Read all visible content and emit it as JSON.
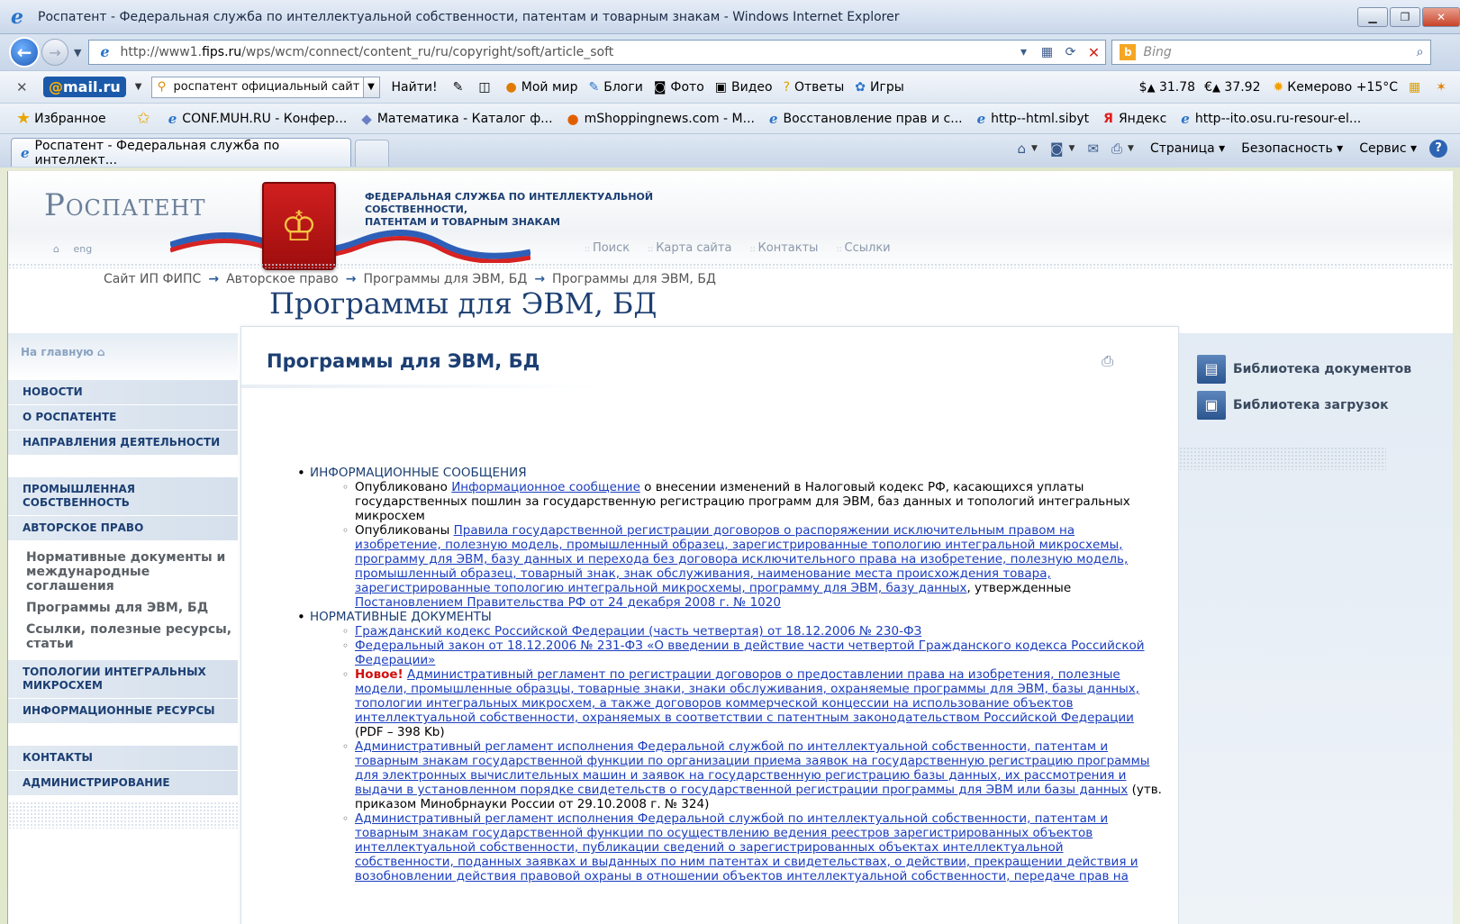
{
  "window": {
    "title": "Роспатент - Федеральная служба по интеллектуальной собственности, патентам и товарным знакам - Windows Internet Explorer"
  },
  "address_bar": {
    "url_prefix": "http://www1.",
    "url_domain": "fips.ru",
    "url_path": "/wps/wcm/connect/content_ru/ru/copyright/soft/article_soft",
    "search_placeholder": "Bing"
  },
  "mail_toolbar": {
    "logo_at": "@",
    "logo_text": "mail.ru",
    "search_value": "роспатент официальный сайт",
    "find_label": "Найти!",
    "items": [
      "Мой мир",
      "Блоги",
      "Фото",
      "Видео",
      "Ответы",
      "Игры"
    ],
    "usd": "31.78",
    "eur": "37.92",
    "weather": "Кемерово +15°C"
  },
  "favorites": {
    "label": "Избранное",
    "items": [
      "CONF.MUH.RU - Конфер...",
      "Математика - Каталог ф...",
      "mShoppingnews.com - M...",
      "Восстановление прав и с...",
      "http--html.sibyt",
      "Яндекс",
      "http--ito.osu.ru-resour-el..."
    ]
  },
  "tab": {
    "title": "Роспатент - Федеральная служба по интеллект..."
  },
  "commands": {
    "page": "Страница",
    "safety": "Безопасность",
    "service": "Сервис"
  },
  "site": {
    "logo": "Роспатент",
    "lang": "eng",
    "agency_line1": "ФЕДЕРАЛЬНАЯ СЛУЖБА ПО ИНТЕЛЛЕКТУАЛЬНОЙ СОБСТВЕННОСТИ,",
    "agency_line2": "ПАТЕНТАМ И ТОВАРНЫМ ЗНАКАМ",
    "top_links": [
      "Поиск",
      "Карта сайта",
      "Контакты",
      "Ссылки"
    ],
    "breadcrumbs": [
      "Сайт ИП ФИПС",
      "Авторское право",
      "Программы для ЭВМ, БД",
      "Программы для ЭВМ, БД"
    ],
    "page_title": "Программы для ЭВМ, БД"
  },
  "left_nav": {
    "home": "На главную",
    "items_top": [
      "Новости",
      "О Роспатенте",
      "Направления деятельности"
    ],
    "items_mid": [
      "Промышленная собственность",
      "Авторское право"
    ],
    "sub_items": [
      "Нормативные документы и международные соглашения",
      "Программы для ЭВМ, БД",
      "Ссылки, полезные ресурсы, статьи"
    ],
    "items_after": [
      "Топологии интегральных микросхем",
      "Информационные ресурсы"
    ],
    "items_bottom": [
      "Контакты",
      "Администрирование"
    ]
  },
  "content": {
    "title": "Программы для ЭВМ, БД",
    "section1": {
      "heading": "ИНФОРМАЦИОННЫЕ СООБЩЕНИЯ",
      "item1_prefix": "Опубликовано ",
      "item1_link": "Информационное сообщение",
      "item1_suffix": " о внесении изменений в Налоговый кодекс РФ, касающихся уплаты государственных пошлин за государственную регистрацию программ для ЭВМ, баз данных и топологий интегральных микросхем",
      "item2_prefix": "Опубликованы ",
      "item2_link": "Правила государственной регистрации договоров о распоряжении исключительным правом на изобретение, полезную модель, промышленный образец, зарегистрированные топологию интегральной микросхемы, программу для ЭВМ, базу данных и перехода без договора исключительного права на изобретение, полезную модель, промышленный образец, товарный знак, знак обслуживания, наименование места происхождения товара, зарегистрированные топологию интегральной микросхемы, программу для ЭВМ, базу данных",
      "item2_mid": ", утвержденные ",
      "item2_link2": "Постановлением Правительства РФ от 24 декабря 2008 г. № 1020"
    },
    "section2": {
      "heading": "НОРМАТИВНЫЕ ДОКУМЕНТЫ",
      "doc1": "Гражданский кодекс Российской Федерации (часть четвертая) от 18.12.2006 № 230-ФЗ",
      "doc2": "Федеральный закон от 18.12.2006 № 231-ФЗ «О введении в действие части четвертой Гражданского кодекса Российской Федерации»",
      "doc3_badge": "Новое!",
      "doc3": "Административный регламент по регистрации договоров о предоставлении права на изобретения, полезные модели, промышленные образцы, товарные знаки, знаки обслуживания, охраняемые программы для ЭВМ, базы данных, топологии интегральных микросхем, а также договоров коммерческой концессии на использование объектов интеллектуальной собственности, охраняемых в соответствии с патентным законодательством Российской Федерации",
      "doc3_note": "(PDF – 398 Kb)",
      "doc4": "Административный регламент исполнения Федеральной службой по интеллектуальной собственности, патентам и товарным знакам государственной функции по организации приема заявок на государственную регистрацию программы для электронных вычислительных машин и заявок на государственную регистрацию базы данных, их рассмотрения и выдачи в установленном порядке свидетельств о государственной регистрации программы для ЭВМ или базы данных",
      "doc4_note": " (утв. приказом Минобрнауки России от 29.10.2008 г. № 324)",
      "doc5": "Административный регламент исполнения Федеральной службой по интеллектуальной собственности, патентам и товарным знакам государственной функции по осуществлению ведения реестров зарегистрированных объектов интеллектуальной собственности, публикации сведений о зарегистрированных объектах интеллектуальной собственности, поданных заявках и выданных по ним патентах и свидетельствах, о действии, прекращении действия и возобновлении действия правовой охраны в отношении объектов интеллектуальной собственности, передаче прав на"
    }
  },
  "right_panel": {
    "items": [
      "Библиотека документов",
      "Библиотека загрузок"
    ]
  }
}
